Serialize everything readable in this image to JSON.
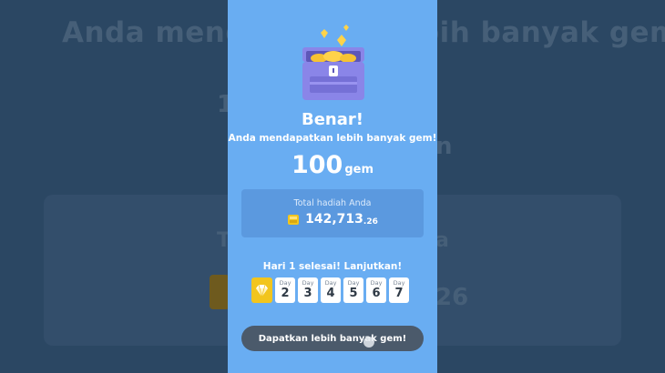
{
  "background": {
    "title": "Anda mendapatkan lebih banyak gem!"
  },
  "modal": {
    "title": "Benar!",
    "subtitle": "Anda mendapatkan lebih banyak gem!",
    "reward_amount": "100",
    "reward_unit": "gem",
    "total_label": "Total hadiah Anda",
    "total_value_main": "142,713",
    "total_value_decimal": ".26",
    "streak_text": "Hari 1 selesai! Lanjutkan!",
    "days": [
      {
        "label": "Day",
        "number": "2"
      },
      {
        "label": "Day",
        "number": "3"
      },
      {
        "label": "Day",
        "number": "4"
      },
      {
        "label": "Day",
        "number": "5"
      },
      {
        "label": "Day",
        "number": "6"
      },
      {
        "label": "Day",
        "number": "7"
      }
    ],
    "button_label": "Dapatkan lebih banyak gem!"
  },
  "icons": {
    "chest": "treasure-chest-icon",
    "gem": "gem-icon",
    "day1": "diamond-badge-icon"
  },
  "colors": {
    "panel": "#69adf2",
    "backdrop": "#2b4763",
    "button": "#4b5a6b",
    "gold": "#f2c51e"
  }
}
